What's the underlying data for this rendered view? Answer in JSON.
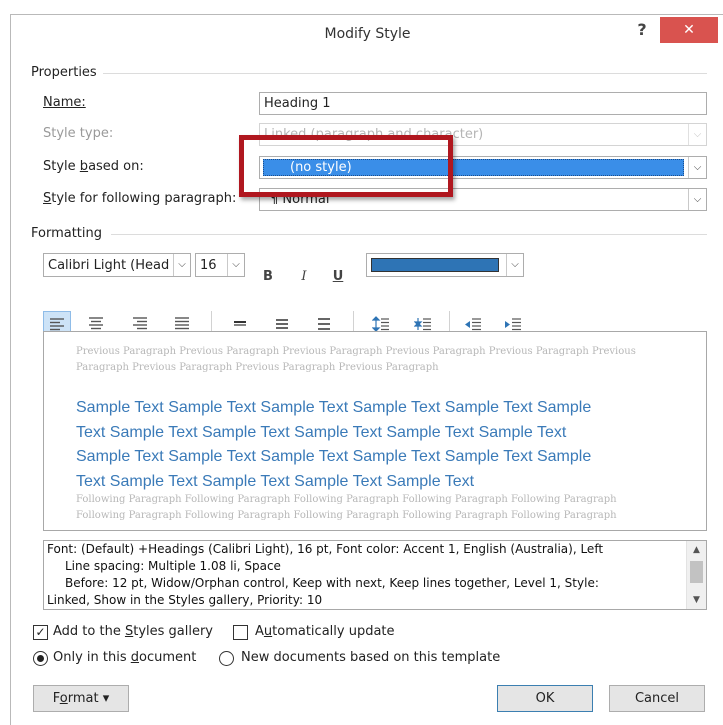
{
  "dialog": {
    "title": "Modify Style",
    "help_label": "?",
    "close_label": "✕"
  },
  "properties": {
    "section_label": "Properties",
    "name_label": "Name:",
    "name_value": "Heading 1",
    "style_type_label": "Style type:",
    "style_type_value": "Linked (paragraph and character)",
    "based_on_label_pre": "Style ",
    "based_on_label_key": "b",
    "based_on_label_post": "ased on:",
    "based_on_value": "(no style)",
    "following_label_pre": "",
    "following_label_key": "S",
    "following_label_post": "tyle for following paragraph:",
    "following_value": "¶  Normal"
  },
  "formatting": {
    "section_label": "Formatting",
    "font_name": "Calibri Light (Head",
    "font_size": "16",
    "bold_label": "B",
    "italic_label": "I",
    "underline_label": "U",
    "font_color": "#2e74b5"
  },
  "preview": {
    "previous_paragraph": "Previous Paragraph Previous Paragraph Previous Paragraph Previous Paragraph Previous Paragraph Previous Paragraph Previous Paragraph Previous Paragraph Previous Paragraph",
    "sample_lines": [
      "Sample Text Sample Text Sample Text Sample Text Sample Text Sample",
      "Text Sample Text Sample Text Sample Text Sample Text Sample Text",
      "Sample Text Sample Text Sample Text Sample Text Sample Text Sample",
      "Text Sample Text Sample Text Sample Text Sample Text"
    ],
    "following_paragraph": "Following Paragraph Following Paragraph Following Paragraph Following Paragraph Following Paragraph Following Paragraph Following Paragraph Following Paragraph Following Paragraph Following Paragraph"
  },
  "description": {
    "line1": "Font: (Default) +Headings (Calibri Light), 16 pt, Font color: Accent 1, English (Australia), Left",
    "line2": "Line spacing:  Multiple 1.08 li, Space",
    "line3": "Before:  12 pt, Widow/Orphan control, Keep with next, Keep lines together, Level 1, Style:",
    "line4": "Linked, Show in the Styles gallery, Priority: 10"
  },
  "options": {
    "add_gallery_pre": "Add to the ",
    "add_gallery_key": "S",
    "add_gallery_post": "tyles gallery",
    "add_gallery_checked": "✓",
    "auto_update_pre": "A",
    "auto_update_key": "u",
    "auto_update_post": "tomatically update",
    "only_doc_pre": "Only in this ",
    "only_doc_key": "d",
    "only_doc_post": "ocument",
    "new_docs_label": "New documents based on this template"
  },
  "buttons": {
    "format_pre": "F",
    "format_key": "o",
    "format_post": "rmat ▾",
    "ok_label": "OK",
    "cancel_label": "Cancel"
  }
}
